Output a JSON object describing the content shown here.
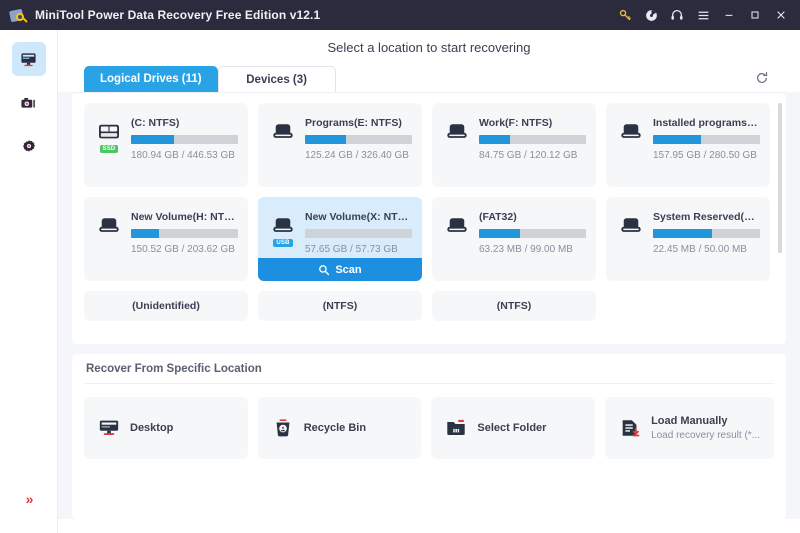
{
  "window": {
    "title": "MiniTool Power Data Recovery Free Edition v12.1",
    "logo_icon": "minitool-logo-icon",
    "controls": {
      "key": "key-icon",
      "disc": "disc-icon",
      "headset": "headset-icon",
      "menu": "hamburger-menu-icon",
      "minimize": "minimize-icon",
      "maximize": "maximize-icon",
      "close": "close-icon"
    }
  },
  "sidebar": {
    "items": [
      {
        "name": "data-recovery",
        "icon": "monitor-icon",
        "active": true
      },
      {
        "name": "snapshot",
        "icon": "camera-icon",
        "active": false
      },
      {
        "name": "settings",
        "icon": "gear-icon",
        "active": false
      }
    ],
    "expand_glyph": "»"
  },
  "main": {
    "page_title": "Select a location to start recovering",
    "tabs": [
      {
        "label": "Logical Drives (11)",
        "active": true
      },
      {
        "label": "Devices (3)",
        "active": false
      }
    ],
    "refresh_icon": "refresh-icon",
    "drives": [
      {
        "name": "(C: NTFS)",
        "size": "180.94 GB / 446.53 GB",
        "percent": 40,
        "badge": "SSD",
        "badge_type": "ssd",
        "icon": "hdd-icon",
        "selected": false
      },
      {
        "name": "Programs(E: NTFS)",
        "size": "125.24 GB / 326.40 GB",
        "percent": 38,
        "badge": "",
        "badge_type": "",
        "icon": "drive-icon",
        "selected": false
      },
      {
        "name": "Work(F: NTFS)",
        "size": "84.75 GB / 120.12 GB",
        "percent": 29,
        "badge": "",
        "badge_type": "",
        "icon": "drive-icon",
        "selected": false
      },
      {
        "name": "Installed programs(G: ...",
        "size": "157.95 GB / 280.50 GB",
        "percent": 45,
        "badge": "",
        "badge_type": "",
        "icon": "drive-icon",
        "selected": false
      },
      {
        "name": "New Volume(H: NTFS)",
        "size": "150.52 GB / 203.62 GB",
        "percent": 26,
        "badge": "",
        "badge_type": "",
        "icon": "drive-icon",
        "selected": false
      },
      {
        "name": "New Volume(X: NTFS)",
        "size": "57.65 GB / 57.73 GB",
        "percent": 0,
        "badge": "USB",
        "badge_type": "usb",
        "icon": "drive-icon",
        "selected": true,
        "scan_label": "Scan",
        "scan_icon": "magnifier-icon"
      },
      {
        "name": "(FAT32)",
        "size": "63.23 MB / 99.00 MB",
        "percent": 38,
        "badge": "",
        "badge_type": "",
        "icon": "drive-icon",
        "selected": false
      },
      {
        "name": "System Reserved(NTFS)",
        "size": "22.45 MB / 50.00 MB",
        "percent": 55,
        "badge": "",
        "badge_type": "",
        "icon": "drive-icon",
        "selected": false
      }
    ],
    "partial_drives": [
      {
        "name": "(Unidentified)"
      },
      {
        "name": "(NTFS)"
      },
      {
        "name": "(NTFS)"
      }
    ],
    "recover_section": {
      "title": "Recover From Specific Location",
      "locations": [
        {
          "label": "Desktop",
          "sub": "",
          "icon": "desktop-icon"
        },
        {
          "label": "Recycle Bin",
          "sub": "",
          "icon": "recycle-bin-icon"
        },
        {
          "label": "Select Folder",
          "sub": "",
          "icon": "folder-icon"
        },
        {
          "label": "Load Manually",
          "sub": "Load recovery result (*...",
          "icon": "load-file-icon"
        }
      ]
    }
  },
  "colors": {
    "titlebar": "#2b2b3d",
    "accent": "#29a3e6",
    "bar_fill": "#2196dd",
    "selected_card": "#d8ecfb",
    "ssd_badge": "#4cc764",
    "usb_badge": "#29a3e6"
  }
}
